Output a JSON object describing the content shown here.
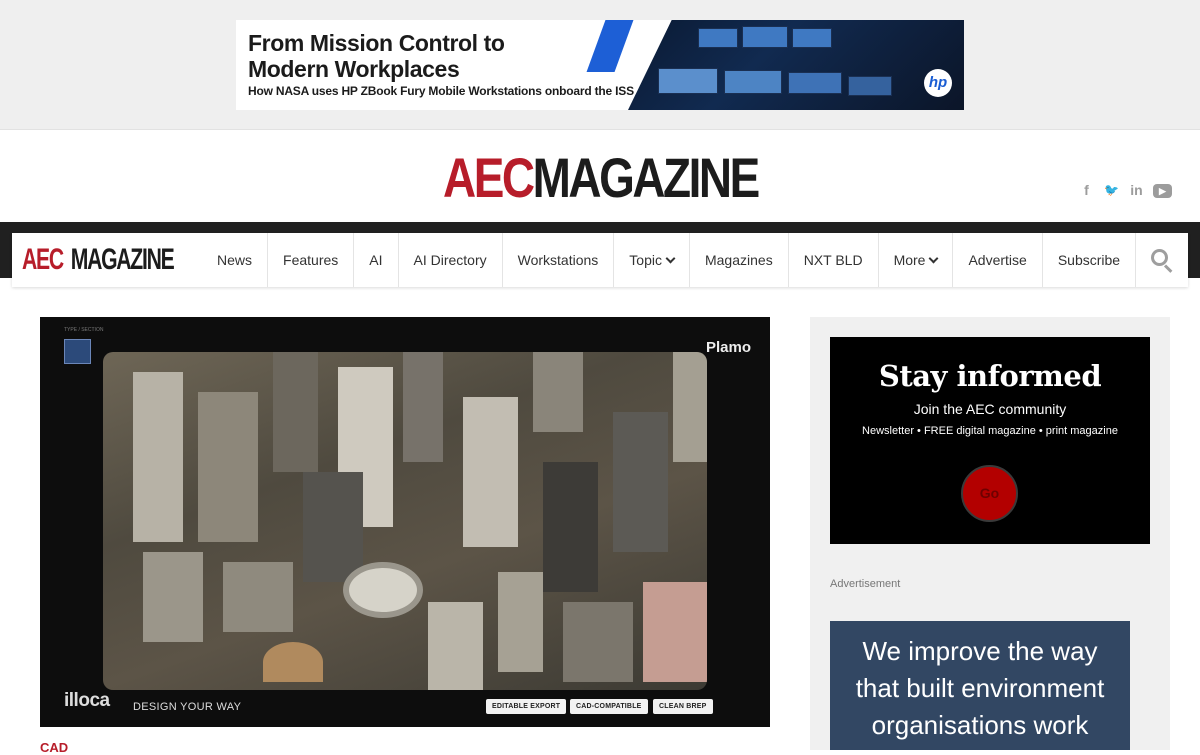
{
  "top_ad": {
    "headline_line1": "From Mission Control to",
    "headline_line2": "Modern Workplaces",
    "subline": "How NASA uses HP ZBook Fury Mobile Workstations onboard the ISS",
    "brand_logo": "hp"
  },
  "masthead": {
    "logo_red": "AEC",
    "logo_dark": "MAGAZINE",
    "socials": [
      {
        "name": "facebook-icon",
        "glyph": "f"
      },
      {
        "name": "twitter-icon",
        "glyph": "🐦"
      },
      {
        "name": "linkedin-icon",
        "glyph": "in"
      },
      {
        "name": "youtube-icon",
        "glyph": "▶"
      }
    ]
  },
  "nav": {
    "logo_red": "AEC",
    "logo_dark": "MAGAZINE",
    "items": [
      "News",
      "Features",
      "AI",
      "AI Directory",
      "Workstations",
      "Topic",
      "Magazines",
      "NXT BLD",
      "More",
      "Advertise",
      "Subscribe"
    ],
    "search_icon": "search-icon"
  },
  "feature": {
    "product_name": "Plamo",
    "brand": "illoca",
    "tagline": "DESIGN YOUR WAY",
    "tags": [
      "EDITABLE EXPORT",
      "CAD-COMPATIBLE",
      "CLEAN BREP"
    ],
    "category": "CAD"
  },
  "sidebar": {
    "stay_title": "Stay informed",
    "stay_sub": "Join the AEC community",
    "stay_small": "Newsletter • FREE digital magazine • print magazine",
    "go_label": "Go",
    "ad_label": "Advertisement",
    "ad_text_line1": "We improve the way",
    "ad_text_line2": "that built environment",
    "ad_text_line3": "organisations work"
  },
  "colors": {
    "brand_red": "#b71d2a",
    "nav_band": "#202020",
    "go_button": "#b30000",
    "side_ad_bg": "#324763"
  }
}
